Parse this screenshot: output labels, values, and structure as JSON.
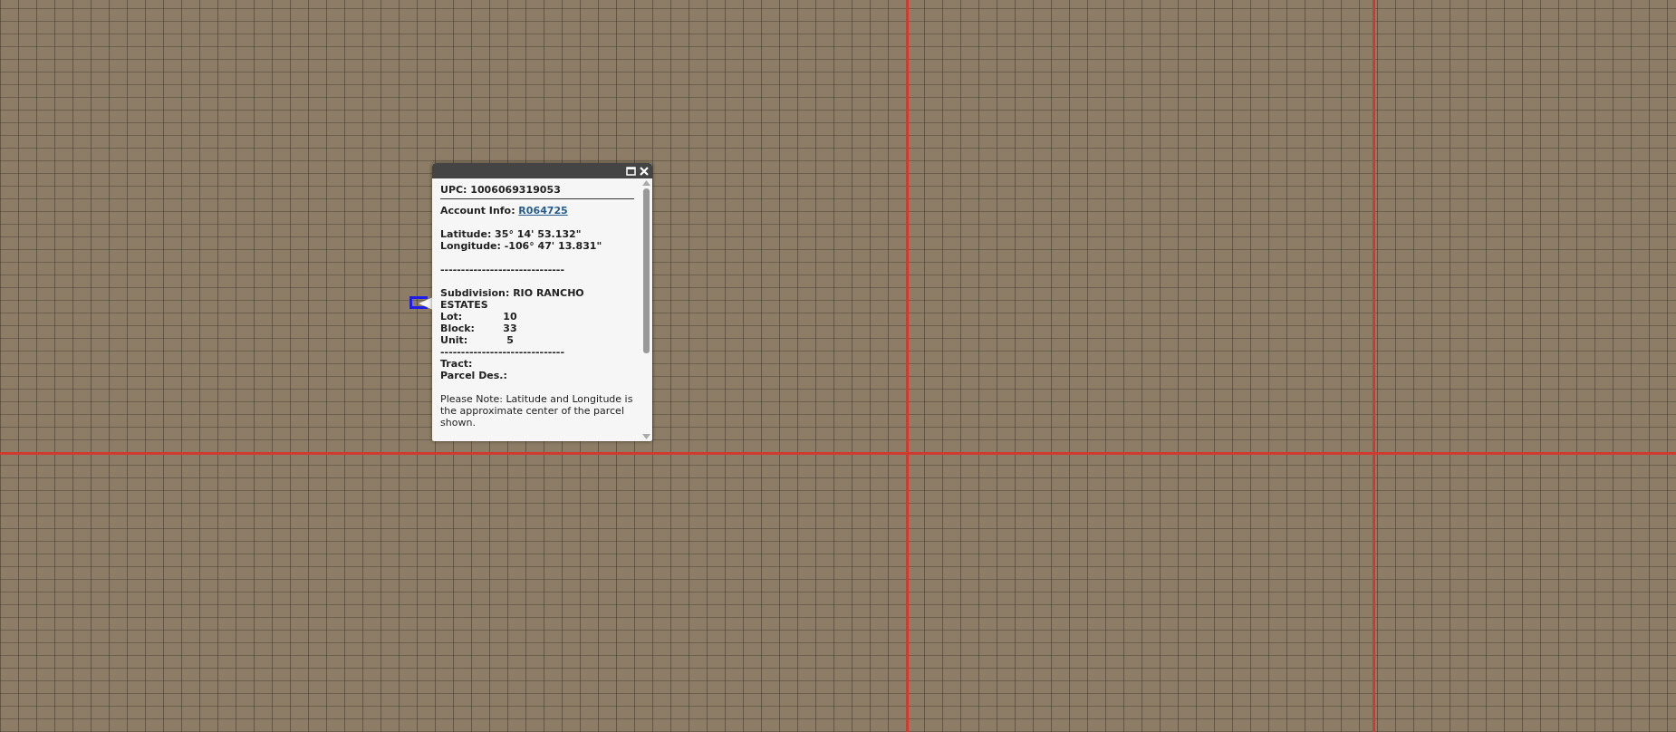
{
  "popup": {
    "upc": "UPC: 1006069319053",
    "account": {
      "label": "Account Info:",
      "link": "R064725"
    },
    "latitude": "Latitude: 35° 14' 53.132\"",
    "longitude": "Longitude: -106° 47' 13.831\"",
    "separators": [
      "------------------------------",
      "------------------------------"
    ],
    "subdivision": "Subdivision: RIO RANCHO ESTATES",
    "details": [
      {
        "label": "Lot:",
        "value": "10"
      },
      {
        "label": "Block:",
        "value": "33"
      },
      {
        "label": "Unit:",
        "value": "5"
      }
    ],
    "tract": "Tract:",
    "parcel_des": "Parcel Des.:",
    "note": "Please Note: Latitude and Longitude is the approximate center of the parcel shown."
  }
}
